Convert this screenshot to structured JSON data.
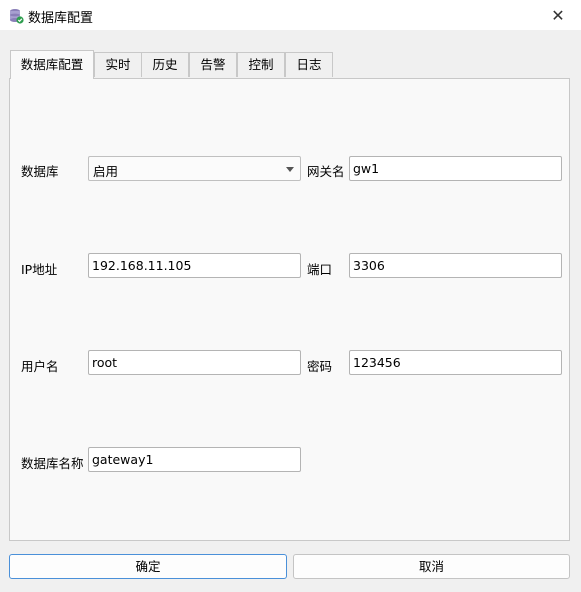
{
  "window": {
    "title": "数据库配置",
    "close_glyph": "✕"
  },
  "tabs": [
    {
      "label": "数据库配置",
      "active": true
    },
    {
      "label": "实时"
    },
    {
      "label": "历史"
    },
    {
      "label": "告警"
    },
    {
      "label": "控制"
    },
    {
      "label": "日志"
    }
  ],
  "form": {
    "database_label": "数据库",
    "database_value": "启用",
    "gateway_name_label": "网关名",
    "gateway_name_value": "gw1",
    "ip_label": "IP地址",
    "ip_value": "192.168.11.105",
    "port_label": "端口",
    "port_value": "3306",
    "username_label": "用户名",
    "username_value": "root",
    "password_label": "密码",
    "password_value": "123456",
    "db_name_label": "数据库名称",
    "db_name_value": "gateway1"
  },
  "buttons": {
    "ok": "确定",
    "cancel": "取消"
  },
  "colors": {
    "focus_border": "#4a90d9",
    "icon_check": "#2e9e4f"
  },
  "icons": {
    "app": "database-check-icon",
    "close": "close-icon",
    "dropdown": "chevron-down-icon"
  }
}
